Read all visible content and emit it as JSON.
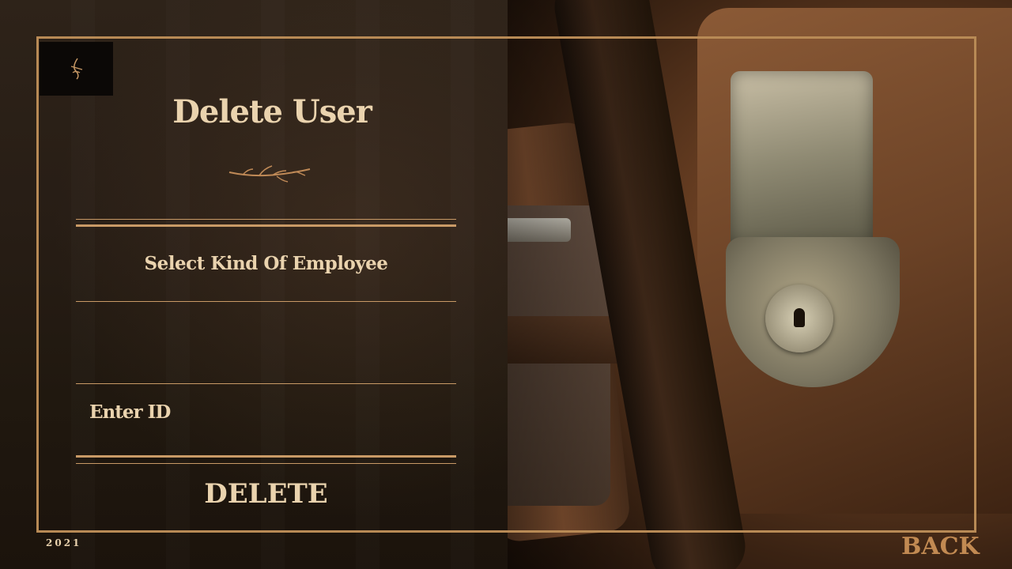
{
  "page": {
    "title": "Delete User",
    "year": "2021"
  },
  "form": {
    "select_label": "Select Kind Of Employee",
    "select_value": "",
    "id_label": "Enter ID",
    "id_value": "",
    "delete_label": "DELETE"
  },
  "nav": {
    "back_label": "BACK"
  },
  "icons": {
    "logo": "monogram-logo",
    "divider": "twig-ornament"
  },
  "colors": {
    "accent_gold": "#b88a55",
    "text_cream": "#ead3ae",
    "back_copper": "#c28a52",
    "panel_dark": "#271d15"
  }
}
